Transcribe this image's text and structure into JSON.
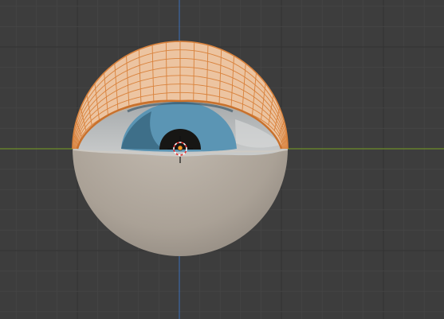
{
  "viewport": {
    "view": "front-orthographic",
    "background_color": "#3d3d3d",
    "grid_minor_color": "#444444",
    "grid_major_color": "#353535",
    "x_axis_color": "#6f8f2a",
    "z_axis_color": "#3f6aa6"
  },
  "scene": {
    "objects": [
      {
        "name": "eyeball",
        "state": "unselected",
        "shading": "solid",
        "color": "#b2a99f"
      },
      {
        "name": "iris",
        "state": "unselected",
        "shading": "solid",
        "color": "#5b95b4"
      },
      {
        "name": "pupil",
        "state": "unselected",
        "shading": "solid",
        "color": "#171614"
      },
      {
        "name": "eyelid",
        "state": "selected",
        "shading": "wireframe-overlay",
        "color": "#f2c7a1",
        "wire_color": "#d9823c"
      }
    ],
    "cursor": {
      "name": "3d-cursor",
      "ring_color_a": "#e83030",
      "ring_color_b": "#ffffff"
    },
    "origin_color": "#ff9a1f"
  }
}
